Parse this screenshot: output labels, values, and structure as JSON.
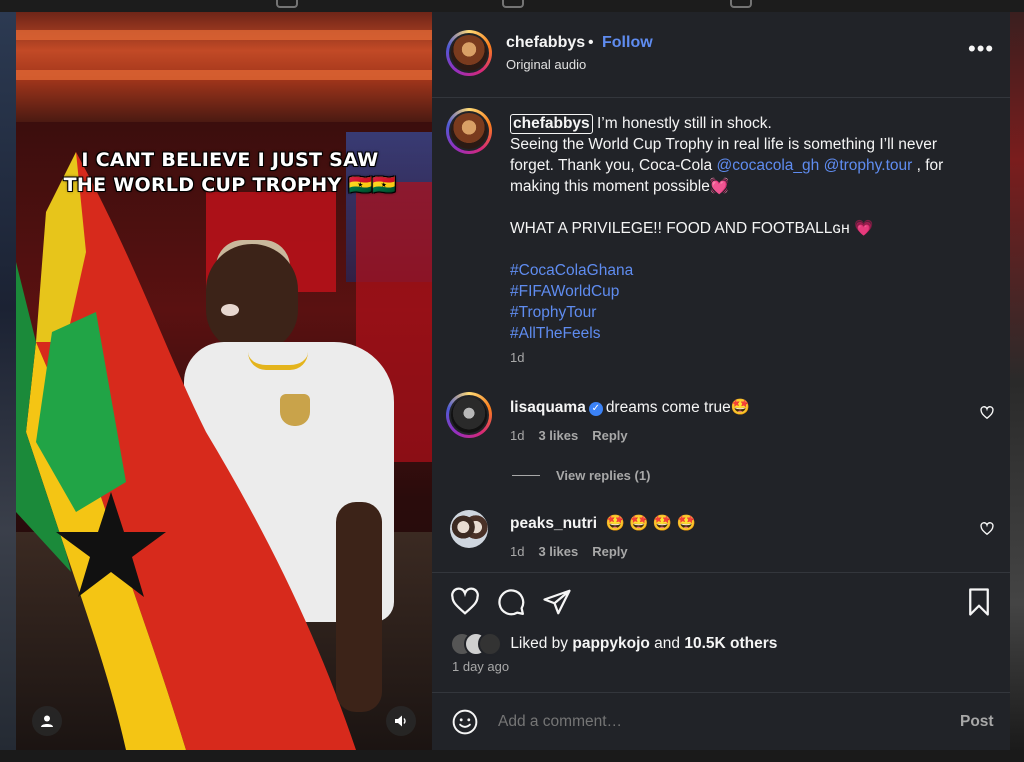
{
  "colors": {
    "accent": "#5f8cf0",
    "panel": "#212328",
    "muted": "#a8a8a8",
    "verified": "#3b82f6"
  },
  "media": {
    "caption_line1": "I CANT BELIEVE I JUST SAW",
    "caption_line2": "THE WORLD CUP TROPHY 🇬🇭🇬🇭",
    "user_icon": "user-icon",
    "sound_icon": "speaker-icon"
  },
  "header": {
    "username": "chefabbys",
    "separator": "•",
    "follow_label": "Follow",
    "subtitle": "Original audio",
    "more_label": "•••"
  },
  "post": {
    "username": "chefabbys",
    "line1": " I’m honestly still in shock.",
    "line2_pre": "Seeing the World Cup Trophy in real life is something I’ll never forget. Thank you, Coca-Cola ",
    "mention1": "@cocacola_gh",
    "mention2": "@trophy.tour",
    "line2_post": " , for making this moment possible💓",
    "line3": "WHAT A PRIVILEGE!! FOOD AND FOOTBALLɢʜ 💗",
    "hashtags": [
      "#CocaColaGhana",
      "#FIFAWorldCup",
      "#TrophyTour",
      "#AllTheFeels"
    ],
    "time": "1d"
  },
  "comments": [
    {
      "username": "lisaquama",
      "verified_mark": "✓",
      "text": "dreams come true🤩",
      "time": "1d",
      "likes": "3 likes",
      "reply": "Reply"
    },
    {
      "username": "peaks_nutri",
      "text": "🤩 🤩 🤩 🤩",
      "time": "1d",
      "likes": "3 likes",
      "reply": "Reply"
    }
  ],
  "view_replies": "View replies (1)",
  "likes": {
    "prefix": "Liked by ",
    "user": "pappykojo",
    "middle": " and ",
    "count": "10.5K others"
  },
  "posted_ago": "1 day ago",
  "composer": {
    "placeholder": "Add a comment…",
    "post_label": "Post"
  }
}
